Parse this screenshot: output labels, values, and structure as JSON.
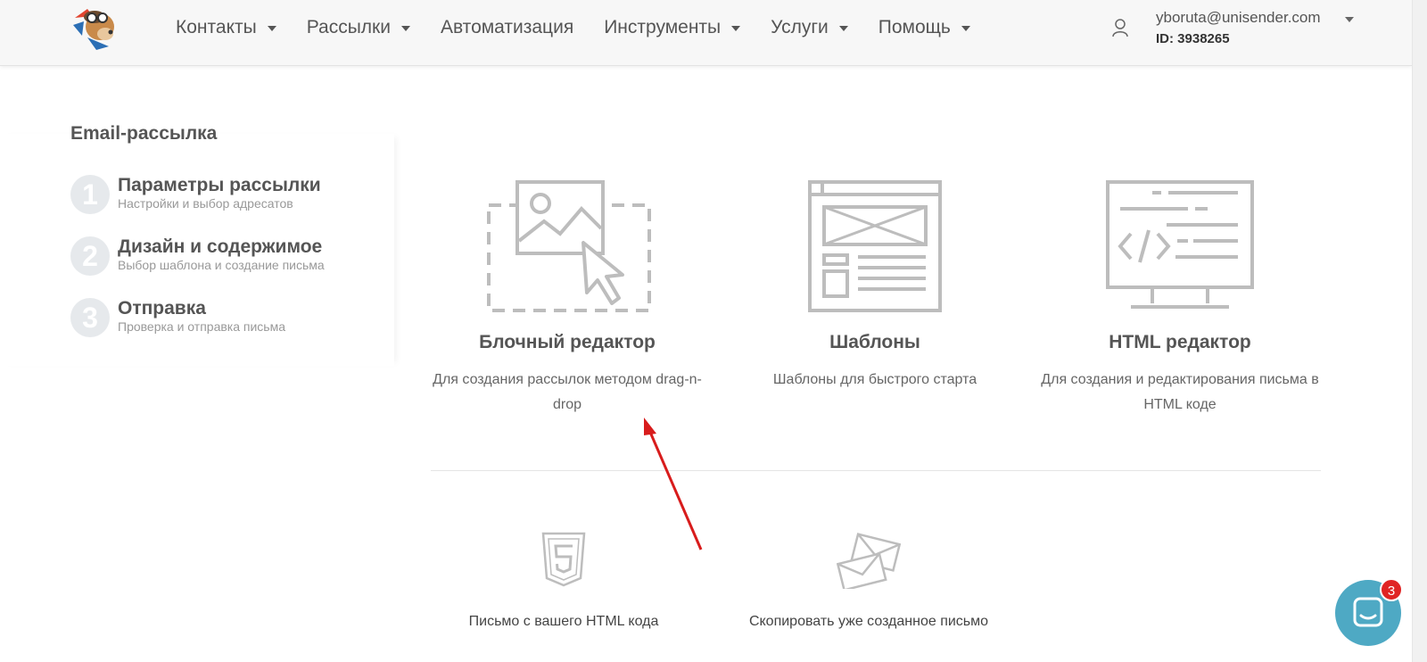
{
  "nav": {
    "items": [
      {
        "label": "Контакты",
        "has_dropdown": true
      },
      {
        "label": "Рассылки",
        "has_dropdown": true
      },
      {
        "label": "Автоматизация",
        "has_dropdown": false
      },
      {
        "label": "Инструменты",
        "has_dropdown": true
      },
      {
        "label": "Услуги",
        "has_dropdown": true
      },
      {
        "label": "Помощь",
        "has_dropdown": true
      }
    ]
  },
  "user": {
    "email": "yboruta@unisender.com",
    "id": "ID: 3938265",
    "icon": "user-icon"
  },
  "sidebar": {
    "title": "Email-рассылка",
    "steps": [
      {
        "number": "1",
        "title": "Параметры рассылки",
        "subtitle": "Настройки и выбор адресатов"
      },
      {
        "number": "2",
        "title": "Дизайн и содержимое",
        "subtitle": "Выбор шаблона и создание письма"
      },
      {
        "number": "3",
        "title": "Отправка",
        "subtitle": "Проверка и отправка письма"
      }
    ]
  },
  "editors": [
    {
      "title": "Блочный редактор",
      "description": "Для создания рассылок методом drag-n-drop",
      "icon": "drag-drop-icon"
    },
    {
      "title": "Шаблоны",
      "description": "Шаблоны для быстрого старта",
      "icon": "template-icon"
    },
    {
      "title": "HTML редактор",
      "description": "Для создания и редактирования письма в HTML коде",
      "icon": "html-code-icon"
    }
  ],
  "extra_options": [
    {
      "label": "Письмо с вашего HTML кода",
      "icon": "html5-icon"
    },
    {
      "label": "Скопировать уже созданное письмо",
      "icon": "envelopes-icon"
    }
  ],
  "chat": {
    "badge_count": "3",
    "icon": "chat-icon"
  },
  "colors": {
    "accent": "#4ea9c4",
    "badge": "#e02424",
    "annotation_arrow": "#d81c1c",
    "icon_gray": "#bdbdbd"
  }
}
